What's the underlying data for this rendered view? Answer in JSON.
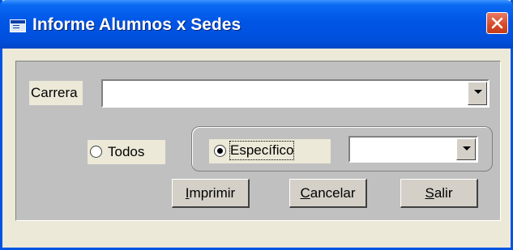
{
  "window": {
    "title": "Informe Alumnos x Sedes"
  },
  "form": {
    "carrera_label": "Carrera",
    "carrera_value": "",
    "radio_todos": {
      "label": "Todos",
      "checked": false
    },
    "radio_especifico": {
      "label": "Específico",
      "checked": true
    },
    "especifico_value": ""
  },
  "buttons": {
    "imprimir": {
      "first": "I",
      "rest": "mprimir"
    },
    "cancelar": {
      "first": "C",
      "rest": "ancelar"
    },
    "salir": {
      "first": "S",
      "rest": "alir"
    }
  },
  "icons": {
    "app": "window-form-icon",
    "close": "close-icon",
    "dropdown": "chevron-down-icon"
  },
  "colors": {
    "titlebar": "#0055e5",
    "close": "#d64a28",
    "panel": "#c0c0c0",
    "window_bg": "#ece9d8"
  }
}
